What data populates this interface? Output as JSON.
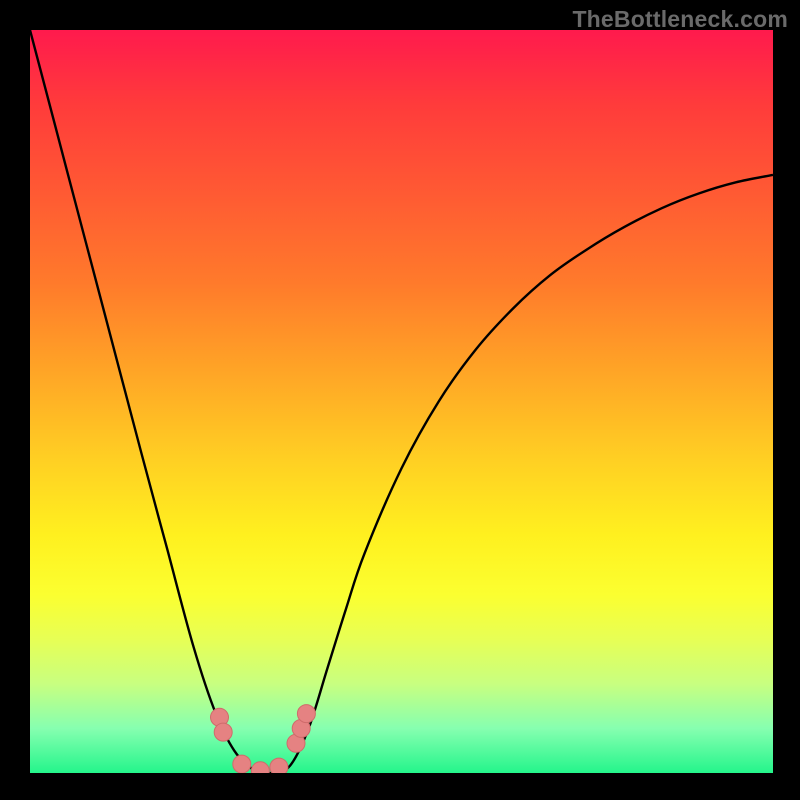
{
  "watermark": "TheBottleneck.com",
  "colors": {
    "frame": "#000000",
    "gradient_top": "#ff1a4d",
    "gradient_bottom": "#24f58b",
    "curve": "#000000",
    "markers_fill": "#e58282",
    "markers_stroke": "#cf6b6b"
  },
  "chart_data": {
    "type": "line",
    "title": "",
    "xlabel": "",
    "ylabel": "",
    "xlim": [
      0,
      1
    ],
    "ylim": [
      0,
      1
    ],
    "note": "No axis ticks or labels visible; x/y values are normalized estimates read from pixel positions. y is bottleneck magnitude (top=high, bottom=low).",
    "series": [
      {
        "name": "bottleneck-curve",
        "x": [
          0.0,
          0.05,
          0.1,
          0.15,
          0.185,
          0.22,
          0.25,
          0.275,
          0.3,
          0.325,
          0.35,
          0.375,
          0.4,
          0.425,
          0.45,
          0.5,
          0.55,
          0.6,
          0.65,
          0.7,
          0.75,
          0.8,
          0.85,
          0.9,
          0.95,
          1.0
        ],
        "y": [
          1.0,
          0.81,
          0.62,
          0.43,
          0.3,
          0.17,
          0.08,
          0.03,
          0.005,
          0.0,
          0.01,
          0.06,
          0.14,
          0.22,
          0.295,
          0.41,
          0.5,
          0.57,
          0.625,
          0.67,
          0.705,
          0.735,
          0.76,
          0.78,
          0.795,
          0.805
        ]
      }
    ],
    "markers": {
      "name": "highlighted-points",
      "x": [
        0.255,
        0.26,
        0.285,
        0.31,
        0.335,
        0.358,
        0.365,
        0.372
      ],
      "y": [
        0.075,
        0.055,
        0.012,
        0.003,
        0.008,
        0.04,
        0.06,
        0.08
      ]
    }
  }
}
